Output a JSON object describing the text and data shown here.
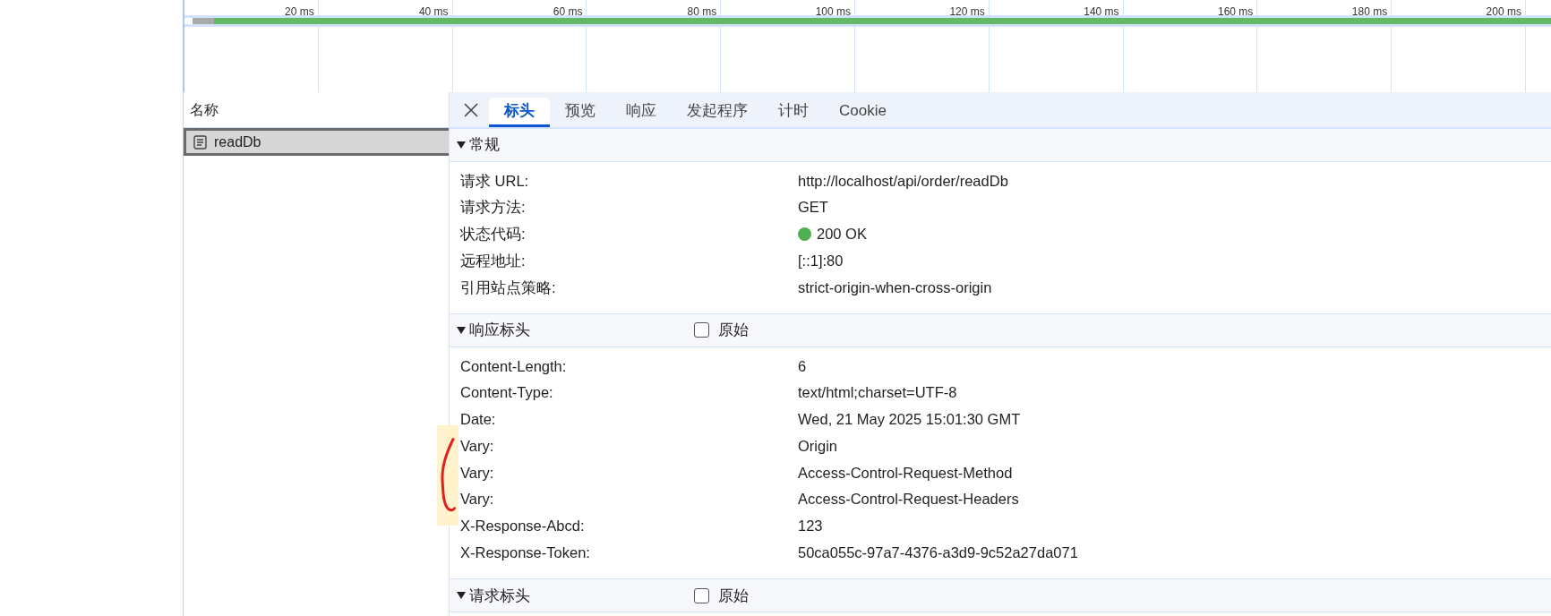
{
  "timeline": {
    "ticks": [
      "20 ms",
      "40 ms",
      "60 ms",
      "80 ms",
      "100 ms",
      "120 ms",
      "140 ms",
      "160 ms",
      "180 ms",
      "200 ms"
    ]
  },
  "name_column": {
    "header": "名称",
    "requests": [
      {
        "name": "readDb",
        "selected": true
      }
    ]
  },
  "details": {
    "tabs": [
      {
        "label": "标头",
        "selected": true
      },
      {
        "label": "预览",
        "selected": false
      },
      {
        "label": "响应",
        "selected": false
      },
      {
        "label": "发起程序",
        "selected": false
      },
      {
        "label": "计时",
        "selected": false
      },
      {
        "label": "Cookie",
        "selected": false
      }
    ],
    "sections": [
      {
        "title": "常规",
        "expanded": true,
        "rows": [
          {
            "key": "请求 URL:",
            "value": "http://localhost/api/order/readDb",
            "kind": "text"
          },
          {
            "key": "请求方法:",
            "value": "GET",
            "kind": "text"
          },
          {
            "key": "状态代码:",
            "value": "200 OK",
            "kind": "status",
            "color": "#4caf50"
          },
          {
            "key": "远程地址:",
            "value": "[::1]:80",
            "kind": "text"
          },
          {
            "key": "引用站点策略:",
            "value": "strict-origin-when-cross-origin",
            "kind": "text"
          }
        ]
      },
      {
        "title": "响应标头",
        "expanded": true,
        "raw": {
          "label": "原始",
          "checked": false
        },
        "rows": [
          {
            "key": "Content-Length:",
            "value": "6",
            "kind": "text"
          },
          {
            "key": "Content-Type:",
            "value": "text/html;charset=UTF-8",
            "kind": "text"
          },
          {
            "key": "Date:",
            "value": "Wed, 21 May 2025 15:01:30 GMT",
            "kind": "text"
          },
          {
            "key": "Vary:",
            "value": "Origin",
            "kind": "text"
          },
          {
            "key": "Vary:",
            "value": "Access-Control-Request-Method",
            "kind": "text"
          },
          {
            "key": "Vary:",
            "value": "Access-Control-Request-Headers",
            "kind": "text"
          },
          {
            "key": "X-Response-Abcd:",
            "value": "123",
            "kind": "text"
          },
          {
            "key": "X-Response-Token:",
            "value": "50ca055c-97a7-4376-a3d9-9c52a27da071",
            "kind": "text"
          }
        ]
      },
      {
        "title": "请求标头",
        "expanded": true,
        "raw": {
          "label": "原始",
          "checked": false
        }
      }
    ]
  }
}
